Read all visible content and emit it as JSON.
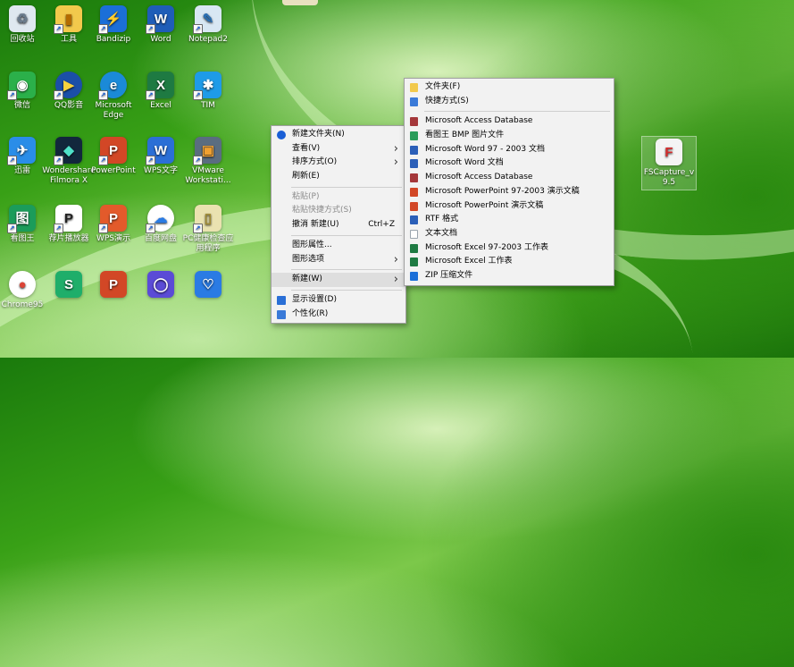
{
  "desktop": {
    "icons": [
      {
        "label": "回收站",
        "glyph": "♻",
        "color": "#dfe8f0",
        "text": "#6b7b8c"
      },
      {
        "label": "工具",
        "glyph": "▮",
        "color": "#f2c94c",
        "text": "#b36b00"
      },
      {
        "label": "Bandizip",
        "glyph": "⚡",
        "color": "#1b6fd8",
        "text": "#ffffff"
      },
      {
        "label": "Word",
        "glyph": "W",
        "color": "#1f5db8",
        "text": "#ffffff"
      },
      {
        "label": "Notepad2",
        "glyph": "✎",
        "color": "#d8e7f3",
        "text": "#2a6fb2"
      },
      {
        "label": "微信",
        "glyph": "◉",
        "color": "#2bb04a",
        "text": "#ffffff"
      },
      {
        "label": "QQ影音",
        "glyph": "▶",
        "color": "#1b4fa8",
        "text": "#f7d23e"
      },
      {
        "label": "Microsoft Edge",
        "glyph": "e",
        "color": "#1b8ad8",
        "text": "#ffffff"
      },
      {
        "label": "Excel",
        "glyph": "X",
        "color": "#1e7a42",
        "text": "#ffffff"
      },
      {
        "label": "TIM",
        "glyph": "✱",
        "color": "#1e9be8",
        "text": "#ffffff"
      },
      {
        "label": "迅雷",
        "glyph": "✈",
        "color": "#2a8de8",
        "text": "#ffffff"
      },
      {
        "label": "Wondershare Filmora X",
        "glyph": "◆",
        "color": "#12273c",
        "text": "#4fe0c8"
      },
      {
        "label": "PowerPoint",
        "glyph": "P",
        "color": "#d24726",
        "text": "#ffffff"
      },
      {
        "label": "WPS文字",
        "glyph": "W",
        "color": "#2b6fd6",
        "text": "#ffffff"
      },
      {
        "label": "VMware Workstati...",
        "glyph": "▣",
        "color": "#5a6d80",
        "text": "#f0a030"
      },
      {
        "label": "看图王",
        "glyph": "图",
        "color": "#1b9c5a",
        "text": "#ffffff"
      },
      {
        "label": "荐片播放器",
        "glyph": "P",
        "color": "#ffffff",
        "text": "#222222"
      },
      {
        "label": "WPS演示",
        "glyph": "P",
        "color": "#e35a2b",
        "text": "#ffffff"
      },
      {
        "label": "百度网盘",
        "glyph": "☁",
        "color": "#ffffff",
        "text": "#2a7be4"
      },
      {
        "label": "PC健康检查应用程序",
        "glyph": "▯",
        "color": "#eae2b0",
        "text": "#a08a30"
      },
      {
        "label": "Chrome95",
        "glyph": "●",
        "color": "#ffffff",
        "text": "#db4437"
      },
      {
        "label": "",
        "glyph": "S",
        "color": "#1fae6a",
        "text": "#ffffff"
      },
      {
        "label": "",
        "glyph": "P",
        "color": "#d24726",
        "text": "#ffffff"
      },
      {
        "label": "",
        "glyph": "◯",
        "color": "#5b4bd6",
        "text": "#ffffff"
      },
      {
        "label": "",
        "glyph": "♡",
        "color": "#2a7be4",
        "text": "#ffffff"
      }
    ],
    "fscapture": {
      "label": "FSCapture_v9.5",
      "glyph": "F",
      "color": "#f4f4f4",
      "text": "#d62a2a"
    }
  },
  "context_menu": {
    "items": [
      {
        "label": "新建文件夹(N)",
        "type": "item",
        "icon": "folder-new-icon",
        "iconColor": "#1a5fd6"
      },
      {
        "label": "查看(V)",
        "type": "submenu"
      },
      {
        "label": "排序方式(O)",
        "type": "submenu"
      },
      {
        "label": "刷新(E)",
        "type": "item"
      },
      {
        "type": "sep"
      },
      {
        "label": "粘贴(P)",
        "type": "item",
        "disabled": true
      },
      {
        "label": "粘贴快捷方式(S)",
        "type": "item",
        "disabled": true
      },
      {
        "label": "撤消 新建(U)",
        "type": "item",
        "shortcut": "Ctrl+Z"
      },
      {
        "type": "sep"
      },
      {
        "label": "图形属性...",
        "type": "item"
      },
      {
        "label": "图形选项",
        "type": "submenu"
      },
      {
        "type": "sep"
      },
      {
        "label": "新建(W)",
        "type": "submenu",
        "highlight": true
      },
      {
        "type": "sep"
      },
      {
        "label": "显示设置(D)",
        "type": "item",
        "icon": "display-icon",
        "iconColor": "#2a6fd6"
      },
      {
        "label": "个性化(R)",
        "type": "item",
        "icon": "personalize-icon",
        "iconColor": "#3a7ad8"
      }
    ]
  },
  "new_submenu": {
    "items": [
      {
        "label": "文件夹(F)",
        "icon": "folder-icon",
        "iconColor": "#f2c94c"
      },
      {
        "label": "快捷方式(S)",
        "icon": "shortcut-icon",
        "iconColor": "#3a7ad8"
      },
      {
        "type": "sep"
      },
      {
        "label": "Microsoft Access Database",
        "icon": "access-icon",
        "iconColor": "#a4373a"
      },
      {
        "label": "看图王 BMP 图片文件",
        "icon": "bmp-icon",
        "iconColor": "#2a9c5a"
      },
      {
        "label": "Microsoft Word 97 - 2003 文档",
        "icon": "word97-icon",
        "iconColor": "#2b5fb8"
      },
      {
        "label": "Microsoft Word 文档",
        "icon": "word-icon",
        "iconColor": "#2b5fb8"
      },
      {
        "label": "Microsoft Access Database",
        "icon": "access-icon",
        "iconColor": "#a4373a"
      },
      {
        "label": "Microsoft PowerPoint 97-2003 演示文稿",
        "icon": "ppt97-icon",
        "iconColor": "#d24726"
      },
      {
        "label": "Microsoft PowerPoint 演示文稿",
        "icon": "ppt-icon",
        "iconColor": "#d24726"
      },
      {
        "label": "RTF 格式",
        "icon": "rtf-icon",
        "iconColor": "#2b5fb8"
      },
      {
        "label": "文本文档",
        "icon": "text-icon",
        "iconColor": "#9aa4ae"
      },
      {
        "label": "Microsoft Excel 97-2003 工作表",
        "icon": "excel97-icon",
        "iconColor": "#1e7a42"
      },
      {
        "label": "Microsoft Excel 工作表",
        "icon": "excel-icon",
        "iconColor": "#1e7a42"
      },
      {
        "label": "ZIP 压缩文件",
        "icon": "zip-icon",
        "iconColor": "#1b6fd8"
      }
    ]
  }
}
